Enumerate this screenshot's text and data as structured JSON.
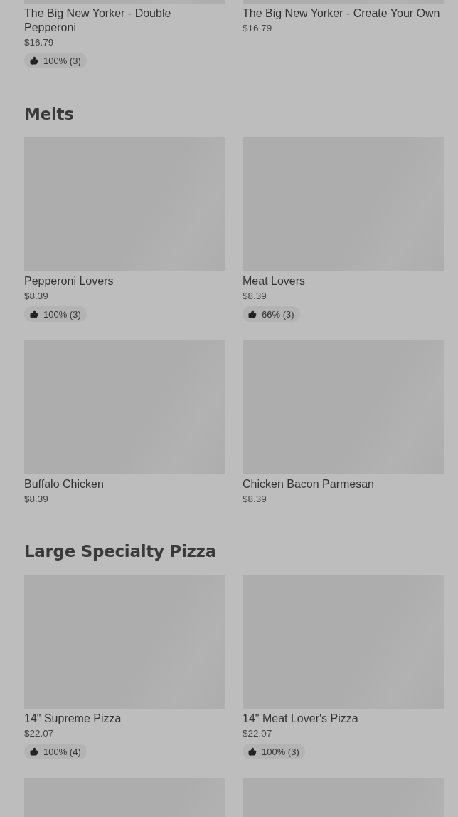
{
  "sections": [
    {
      "items": [
        {
          "kind": "full",
          "title": "The Big New Yorker - Double Pepperoni",
          "price": "$16.79",
          "rating": "100% (3)"
        },
        {
          "kind": "full",
          "title": "The Big New Yorker - Create Your Own",
          "price": "$16.79"
        }
      ]
    },
    {
      "heading": "Melts",
      "items": [
        {
          "kind": "full",
          "title": "Pepperoni Lovers",
          "price": "$8.39",
          "rating": "100% (3)"
        },
        {
          "kind": "full",
          "title": "Meat Lovers",
          "price": "$8.39",
          "rating": "66% (3)"
        },
        {
          "kind": "full",
          "title": "Buffalo Chicken",
          "price": "$8.39"
        },
        {
          "kind": "full",
          "title": "Chicken Bacon Parmesan",
          "price": "$8.39"
        }
      ]
    },
    {
      "heading": "Large Specialty Pizza",
      "items": [
        {
          "kind": "full",
          "title": "14\" Supreme Pizza",
          "price": "$22.07",
          "rating": "100% (4)"
        },
        {
          "kind": "full",
          "title": "14\" Meat Lover's Pizza",
          "price": "$22.07",
          "rating": "100% (3)"
        },
        {
          "kind": "cut"
        },
        {
          "kind": "cut"
        }
      ]
    }
  ]
}
